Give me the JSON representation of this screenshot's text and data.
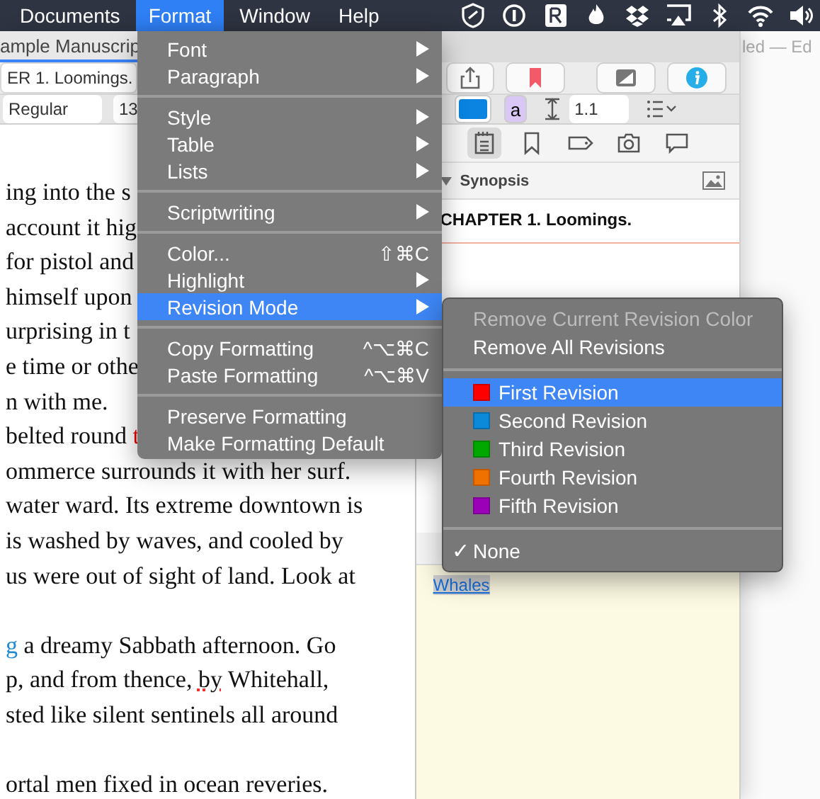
{
  "menu_bar": {
    "items": [
      {
        "label": "Documents",
        "selected": false
      },
      {
        "label": "Format",
        "selected": true
      },
      {
        "label": "Window",
        "selected": false
      },
      {
        "label": "Help",
        "selected": false
      }
    ]
  },
  "window": {
    "tab_title": "ample Manuscrip",
    "background_window_title": "led — Ed"
  },
  "toolbar": {
    "search_value": "ER 1. Loomings."
  },
  "format_bar": {
    "font_style": "Regular",
    "font_size": "13",
    "highlight_sample": "a",
    "line_spacing": "1.1"
  },
  "document": {
    "paragraphs": [
      {
        "lines": [
          [
            {
              "text": "ing into the s",
              "kind": "plain"
            }
          ],
          [
            {
              "text": "account it hig",
              "kind": "plain"
            }
          ],
          [
            {
              "text": "for pistol and",
              "kind": "plain"
            }
          ],
          [
            {
              "text": "himself upon",
              "kind": "plain"
            }
          ],
          [
            {
              "text": "urprising in t",
              "kind": "plain"
            }
          ],
          [
            {
              "text": "e time or othe",
              "kind": "plain"
            }
          ],
          [
            {
              "text": "n with me.",
              "kind": "plain"
            }
          ],
          [
            {
              "text": "belted round ",
              "kind": "plain"
            },
            {
              "text": "t",
              "kind": "revised"
            }
          ],
          [
            {
              "text": "ommerce surrounds it with her surf.",
              "kind": "plain"
            }
          ],
          [
            {
              "text": "water ward. Its extreme downtown is",
              "kind": "plain"
            }
          ],
          [
            {
              "text": "is washed by waves, and cooled by",
              "kind": "plain"
            }
          ],
          [
            {
              "text": "us were out of sight of land. Look at",
              "kind": "plain"
            }
          ]
        ]
      },
      {
        "lines": [
          [
            {
              "text": "g",
              "kind": "link"
            },
            {
              "text": " a dreamy Sabbath afternoon. Go",
              "kind": "plain"
            }
          ],
          [
            {
              "text": "p, and from thence, ",
              "kind": "plain"
            },
            {
              "text": "by",
              "kind": "misspelled"
            },
            {
              "text": " Whitehall,",
              "kind": "plain"
            }
          ],
          [
            {
              "text": "sted like silent sentinels all around",
              "kind": "plain"
            }
          ]
        ]
      },
      {
        "lines": [
          [
            {
              "text": "ortal men fixed in ocean reveries.",
              "kind": "plain"
            }
          ]
        ]
      }
    ]
  },
  "inspector": {
    "tabs": [
      {
        "kind": "notes",
        "selected": true
      },
      {
        "kind": "bookmark",
        "selected": false
      },
      {
        "kind": "tag",
        "selected": false
      },
      {
        "kind": "camera",
        "selected": false
      },
      {
        "kind": "comment",
        "selected": false
      }
    ],
    "section_title": "Synopsis",
    "synopsis": "CHAPTER 1. Loomings.",
    "notes_link": "Whales"
  },
  "format_menu": {
    "items": [
      {
        "kind": "item",
        "label": "Font",
        "submenu": true,
        "selected": false
      },
      {
        "kind": "item",
        "label": "Paragraph",
        "submenu": true,
        "selected": false
      },
      {
        "kind": "separator"
      },
      {
        "kind": "item",
        "label": "Style",
        "submenu": true,
        "selected": false
      },
      {
        "kind": "item",
        "label": "Table",
        "submenu": true,
        "selected": false
      },
      {
        "kind": "item",
        "label": "Lists",
        "submenu": true,
        "selected": false
      },
      {
        "kind": "separator"
      },
      {
        "kind": "item",
        "label": "Scriptwriting",
        "submenu": true,
        "selected": false
      },
      {
        "kind": "separator"
      },
      {
        "kind": "item",
        "label": "Color...",
        "shortcut": "⇧⌘C",
        "submenu": false,
        "selected": false
      },
      {
        "kind": "item",
        "label": "Highlight",
        "submenu": true,
        "selected": false
      },
      {
        "kind": "item",
        "label": "Revision Mode",
        "submenu": true,
        "selected": true
      },
      {
        "kind": "separator"
      },
      {
        "kind": "item",
        "label": "Copy Formatting",
        "shortcut": "^⌥⌘C",
        "submenu": false,
        "selected": false
      },
      {
        "kind": "item",
        "label": "Paste Formatting",
        "shortcut": "^⌥⌘V",
        "submenu": false,
        "selected": false
      },
      {
        "kind": "separator"
      },
      {
        "kind": "item",
        "label": "Preserve Formatting",
        "submenu": false,
        "selected": false
      },
      {
        "kind": "item",
        "label": "Make Formatting Default",
        "submenu": false,
        "selected": false
      }
    ]
  },
  "revision_menu": {
    "check_glyph": "✓",
    "items": [
      {
        "kind": "item",
        "label": "Remove Current Revision Color",
        "disabled": true,
        "selected": false,
        "checked": false
      },
      {
        "kind": "item",
        "label": "Remove All Revisions",
        "disabled": false,
        "selected": false,
        "checked": false
      },
      {
        "kind": "separator"
      },
      {
        "kind": "revision",
        "label": "First Revision",
        "color": "#ff0000",
        "disabled": false,
        "selected": true,
        "checked": false
      },
      {
        "kind": "revision",
        "label": "Second Revision",
        "color": "#0a8ad8",
        "disabled": false,
        "selected": false,
        "checked": false
      },
      {
        "kind": "revision",
        "label": "Third Revision",
        "color": "#00a800",
        "disabled": false,
        "selected": false,
        "checked": false
      },
      {
        "kind": "revision",
        "label": "Fourth Revision",
        "color": "#f07000",
        "disabled": false,
        "selected": false,
        "checked": false
      },
      {
        "kind": "revision",
        "label": "Fifth Revision",
        "color": "#9b00b8",
        "disabled": false,
        "selected": false,
        "checked": false
      },
      {
        "kind": "separator"
      },
      {
        "kind": "item",
        "label": "None",
        "disabled": false,
        "selected": false,
        "checked": true
      }
    ]
  }
}
